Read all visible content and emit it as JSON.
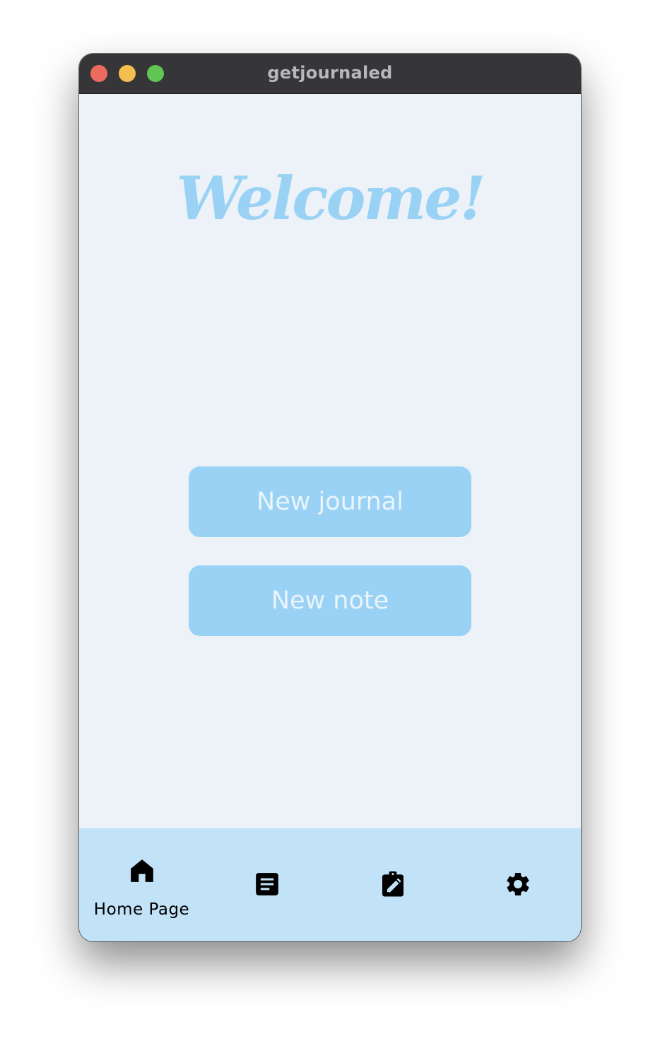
{
  "window": {
    "title": "getjournaled"
  },
  "main": {
    "welcome": "Welcome!",
    "buttons": {
      "new_journal": "New journal",
      "new_note": "New note"
    }
  },
  "nav": {
    "items": [
      {
        "icon": "home-icon",
        "label": "Home Page",
        "selected": true
      },
      {
        "icon": "notes-icon",
        "label": ""
      },
      {
        "icon": "clipboard-edit-icon",
        "label": ""
      },
      {
        "icon": "gear-icon",
        "label": ""
      }
    ]
  },
  "colors": {
    "titlebar": "#363638",
    "background": "#ecf2f7",
    "accent": "#99d2f5",
    "nav_background": "#c2e3f7",
    "button_text": "#eaf4fb",
    "traffic_close": "#ed6a5e",
    "traffic_minimize": "#f5bf4f",
    "traffic_zoom": "#61c554"
  }
}
